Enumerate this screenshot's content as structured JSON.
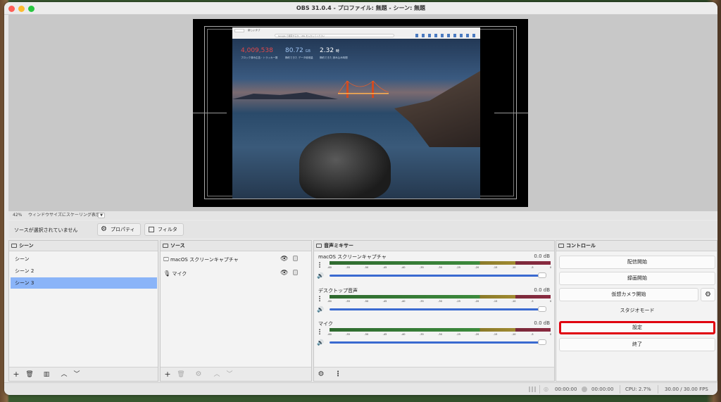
{
  "window": {
    "title": "OBS 31.0.4 - プロファイル: 無題 - シーン: 無題"
  },
  "preview": {
    "stats": [
      {
        "value": "4,009,538",
        "color": "#e0484a",
        "label": "ブロック済み広告・トラッカー数"
      },
      {
        "value": "80.72",
        "unit": "GB",
        "color": "#9ec3f0",
        "label": "節約できた データ使用量"
      },
      {
        "value": "2.32",
        "unit": "時",
        "color": "#ffffff",
        "label": "節約できた 読み込み時間"
      }
    ],
    "search_placeholder": "Google で検索するか、URL を入力してください",
    "tab_label": "新しいタブ"
  },
  "zoombar": {
    "zoom": "42%",
    "scaling_label": "ウィンドウサイズにスケーリング表示"
  },
  "source_bar": {
    "no_source": "ソースが選択されていません",
    "properties": "プロパティ",
    "filters": "フィルタ"
  },
  "scenes": {
    "title": "シーン",
    "items": [
      {
        "label": "シーン"
      },
      {
        "label": "シーン 2"
      },
      {
        "label": "シーン 3"
      }
    ],
    "selected_index": 2
  },
  "sources": {
    "title": "ソース",
    "items": [
      {
        "label": "macOS スクリーンキャプチャ"
      },
      {
        "label": "マイク"
      }
    ]
  },
  "mixer": {
    "title": "音声ミキサー",
    "ticks": [
      "-60",
      "-55",
      "-50",
      "-45",
      "-40",
      "-35",
      "-30",
      "-25",
      "-20",
      "-15",
      "-10",
      "-5",
      "0"
    ],
    "channels": [
      {
        "name": "macOS スクリーンキャプチャ",
        "db": "0.0 dB"
      },
      {
        "name": "デスクトップ音声",
        "db": "0.0 dB"
      },
      {
        "name": "マイク",
        "db": "0.0 dB"
      }
    ]
  },
  "controls": {
    "title": "コントロール",
    "buttons": [
      {
        "label": "配信開始"
      },
      {
        "label": "録画開始"
      },
      {
        "label": "仮想カメラ開始"
      },
      {
        "label": "スタジオモード"
      },
      {
        "label": "設定"
      },
      {
        "label": "終了"
      }
    ],
    "highlight_color": "#e0000f"
  },
  "statusbar": {
    "rec_time": "00:00:00",
    "stream_time": "00:00:00",
    "cpu": "CPU: 2.7%",
    "fps": "30.00 / 30.00 FPS"
  }
}
